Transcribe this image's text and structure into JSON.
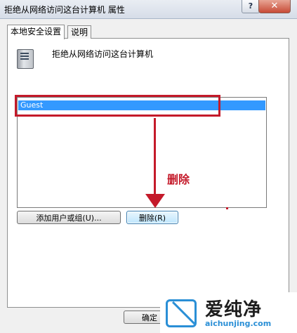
{
  "window": {
    "title": "拒绝从网络访问这台计算机 属性",
    "help_label": "?",
    "close_label": "✕"
  },
  "tabs": [
    {
      "label": "本地安全设置"
    },
    {
      "label": "说明"
    }
  ],
  "policy": {
    "icon": "server-policy-icon",
    "title": "拒绝从网络访问这台计算机"
  },
  "accounts": [
    "Guest"
  ],
  "annotation": {
    "label": "删除",
    "color": "#c41a2a"
  },
  "buttons": {
    "add": "添加用户或组(U)...",
    "remove": "删除(R)",
    "ok": "确定"
  },
  "logo": {
    "cn": "爱纯净",
    "url": "aichunjing.com"
  },
  "colors": {
    "selection": "#3399ff",
    "annotation": "#c41a2a"
  }
}
